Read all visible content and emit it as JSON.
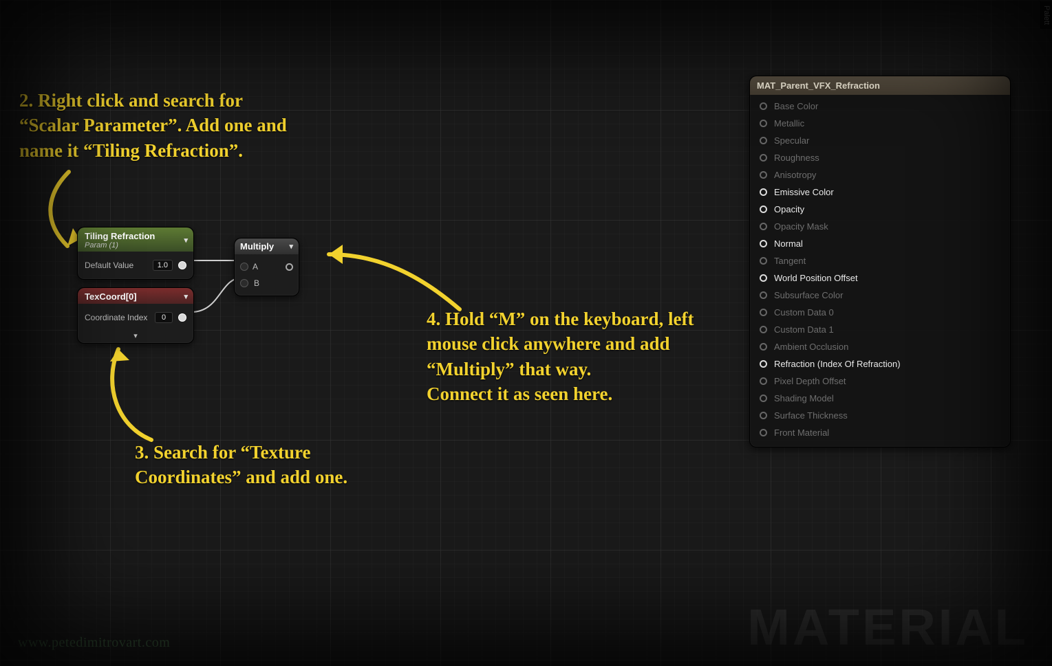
{
  "annotations": {
    "step2": "2. Right click and search for\n“Scalar Parameter”. Add one and\nname it “Tiling Refraction”.",
    "step3": "3. Search for “Texture\nCoordinates” and add one.",
    "step4": "4. Hold “M” on the keyboard, left\nmouse click anywhere and add\n“Multiply” that way.\nConnect it as seen here."
  },
  "nodes": {
    "scalar": {
      "title": "Tiling Refraction",
      "subtitle": "Param (1)",
      "default_label": "Default Value",
      "default_value": "1.0"
    },
    "texcoord": {
      "title": "TexCoord[0]",
      "coord_label": "Coordinate Index",
      "coord_value": "0"
    },
    "multiply": {
      "title": "Multiply",
      "in_a": "A",
      "in_b": "B"
    }
  },
  "output_node": {
    "title": "MAT_Parent_VFX_Refraction",
    "pins": [
      {
        "label": "Base Color",
        "active": false
      },
      {
        "label": "Metallic",
        "active": false
      },
      {
        "label": "Specular",
        "active": false
      },
      {
        "label": "Roughness",
        "active": false
      },
      {
        "label": "Anisotropy",
        "active": false
      },
      {
        "label": "Emissive Color",
        "active": true
      },
      {
        "label": "Opacity",
        "active": true
      },
      {
        "label": "Opacity Mask",
        "active": false
      },
      {
        "label": "Normal",
        "active": true
      },
      {
        "label": "Tangent",
        "active": false
      },
      {
        "label": "World Position Offset",
        "active": true
      },
      {
        "label": "Subsurface Color",
        "active": false
      },
      {
        "label": "Custom Data 0",
        "active": false
      },
      {
        "label": "Custom Data 1",
        "active": false
      },
      {
        "label": "Ambient Occlusion",
        "active": false
      },
      {
        "label": "Refraction (Index Of Refraction)",
        "active": true
      },
      {
        "label": "Pixel Depth Offset",
        "active": false
      },
      {
        "label": "Shading Model",
        "active": false
      },
      {
        "label": "Surface Thickness",
        "active": false
      },
      {
        "label": "Front Material",
        "active": false
      }
    ]
  },
  "watermark_url": "www.petedimitrovart.com",
  "watermark_big": "MATERIAL",
  "palette_tab": "Palett"
}
